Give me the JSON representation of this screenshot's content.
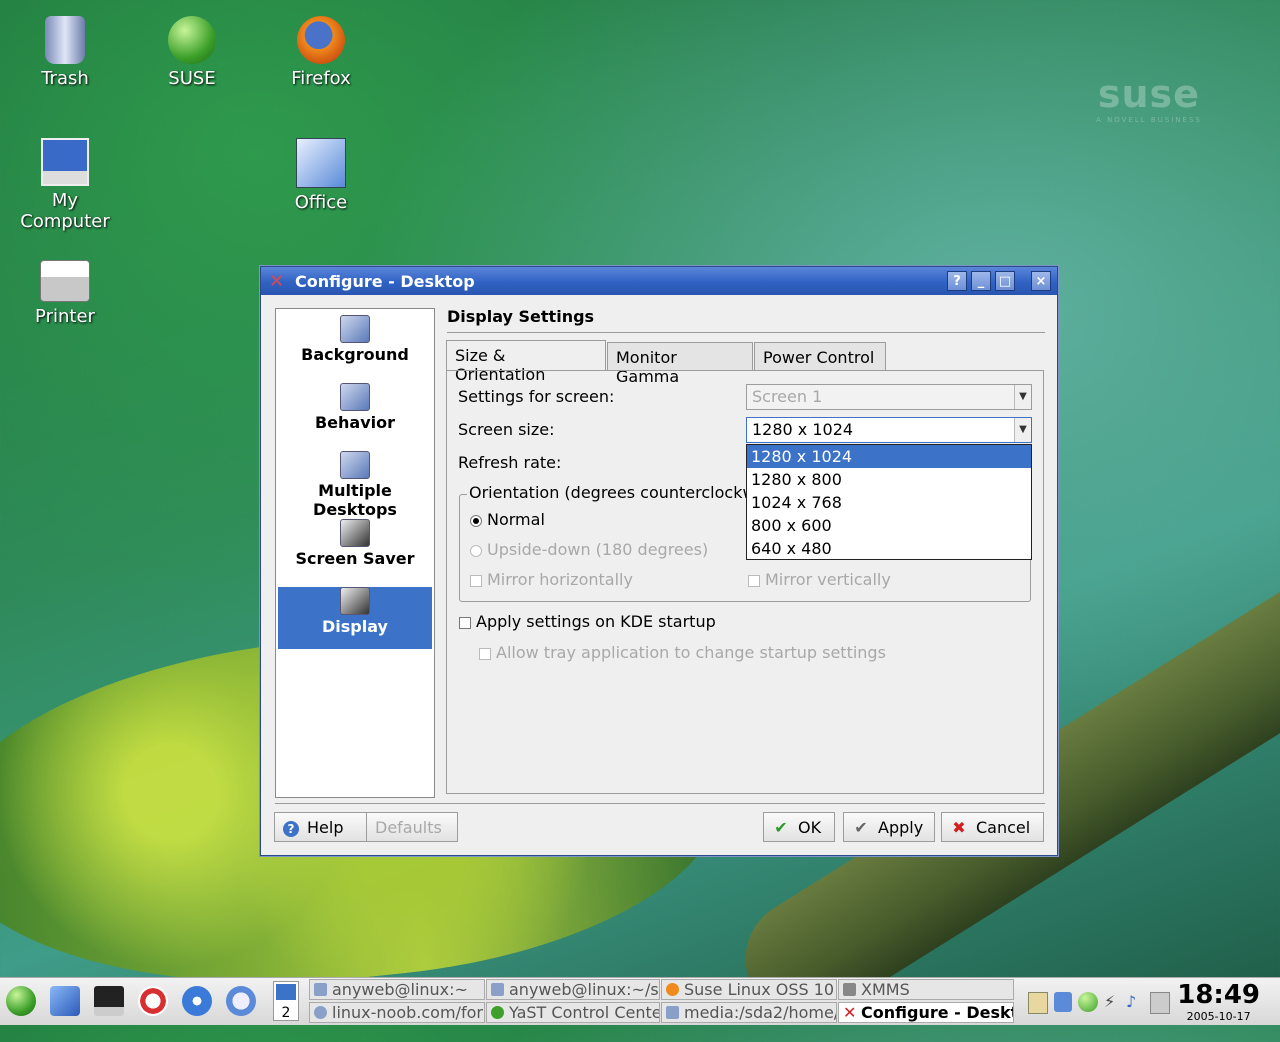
{
  "desktop": {
    "icons": [
      {
        "label": "Trash"
      },
      {
        "label": "SUSE"
      },
      {
        "label": "Firefox"
      },
      {
        "label": "My Computer"
      },
      {
        "label": "Office"
      },
      {
        "label": "Printer"
      }
    ],
    "brand": {
      "word": "suse",
      "sub": "A NOVELL BUSINESS"
    }
  },
  "window": {
    "title": "Configure - Desktop",
    "title_buttons": [
      "?",
      "_",
      "□",
      "×"
    ],
    "sidebar": [
      {
        "label": "Background",
        "icon": "background-icon"
      },
      {
        "label": "Behavior",
        "icon": "behavior-icon"
      },
      {
        "label": "Multiple Desktops",
        "icon": "desktops-icon"
      },
      {
        "label": "Screen Saver",
        "icon": "screensaver-icon"
      },
      {
        "label": "Display",
        "icon": "display-icon",
        "selected": true
      }
    ],
    "section_title": "Display Settings",
    "tabs": [
      "Size & Orientation",
      "Monitor Gamma",
      "Power Control"
    ],
    "active_tab": "Size & Orientation",
    "settings_for_screen_label": "Settings for screen:",
    "settings_for_screen_value": "Screen 1",
    "screen_size_label": "Screen size:",
    "screen_size_value": "1280 x 1024",
    "screen_size_options": [
      "1280 x 1024",
      "1280 x 800",
      "1024 x 768",
      "800 x 600",
      "640 x 480"
    ],
    "refresh_rate_label": "Refresh rate:",
    "orientation_title": "Orientation (degrees counterclockwi",
    "orientation_options": [
      "Normal",
      "Upside-down (180 degrees)"
    ],
    "mirror_h": "Mirror horizontally",
    "mirror_v": "Mirror vertically",
    "apply_startup": "Apply settings on KDE startup",
    "allow_tray": "Allow tray application to change startup settings",
    "buttons": {
      "help": "Help",
      "defaults": "Defaults",
      "ok": "OK",
      "apply": "Apply",
      "cancel": "Cancel"
    },
    "accent": "#3c72c8"
  },
  "taskbar": {
    "desktop_number": "2",
    "tasks_top": [
      "anyweb@linux:~",
      "anyweb@linux:~/su",
      "Suse Linux OSS 10",
      "XMMS"
    ],
    "tasks_bottom": [
      "linux-noob.com/foru",
      "YaST Control Cente",
      "media:/sda2/home/",
      "Configure - Deskt"
    ],
    "clock_time": "18:49",
    "clock_date": "2005-10-17"
  }
}
